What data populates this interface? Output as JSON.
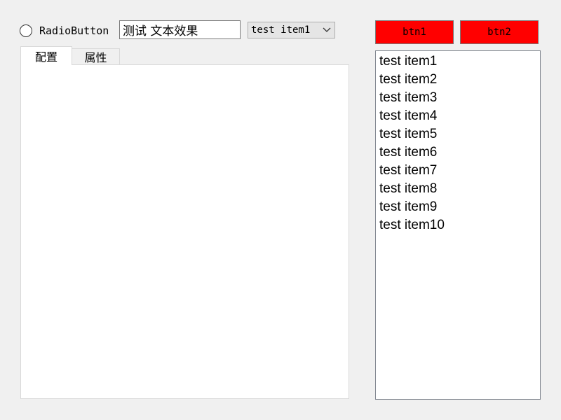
{
  "radio": {
    "label": "RadioButton",
    "checked": false
  },
  "text_input": {
    "value": "测试 文本效果"
  },
  "combo": {
    "selected": "test item1",
    "icon": "chevron-down-icon"
  },
  "tabs": [
    {
      "label": "配置",
      "active": true
    },
    {
      "label": "属性",
      "active": false
    }
  ],
  "buttons": {
    "btn1_label": "btn1",
    "btn2_label": "btn2",
    "color": "#ff0000"
  },
  "list": {
    "items": [
      "test item1",
      "test item2",
      "test item3",
      "test item4",
      "test item5",
      "test item6",
      "test item7",
      "test item8",
      "test item9",
      "test item10"
    ]
  }
}
